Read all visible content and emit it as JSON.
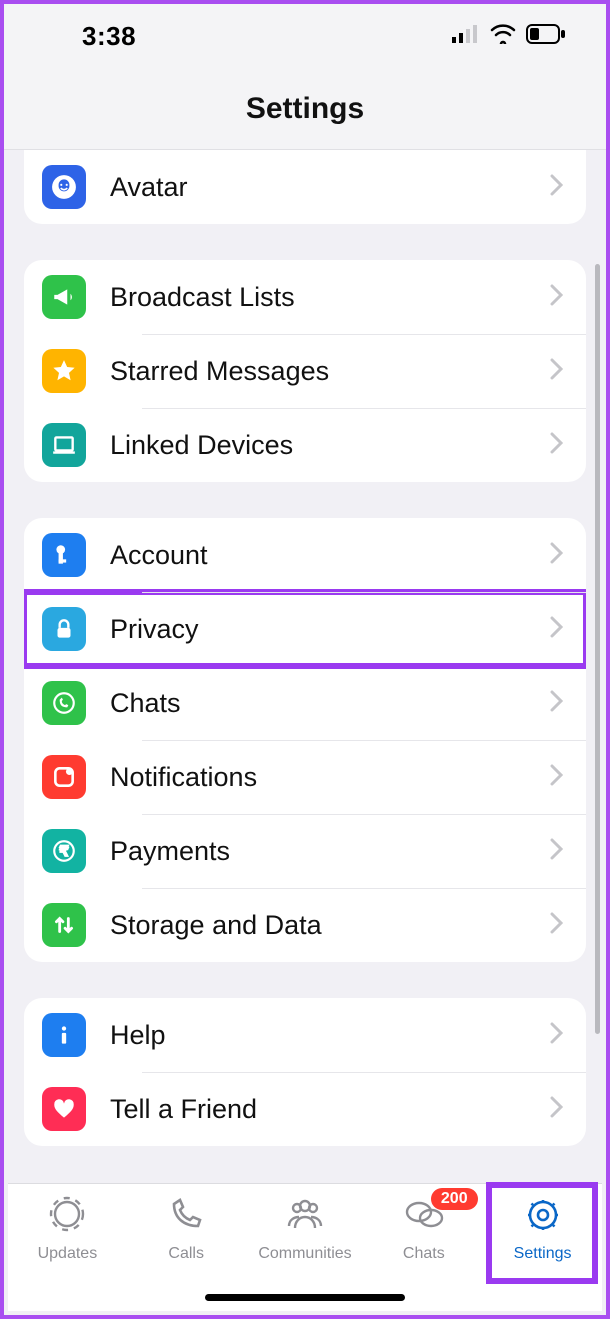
{
  "status": {
    "time": "3:38"
  },
  "header": {
    "title": "Settings"
  },
  "group1": {
    "avatar": "Avatar"
  },
  "group2": {
    "broadcast": "Broadcast Lists",
    "starred": "Starred Messages",
    "linked": "Linked Devices"
  },
  "group3": {
    "account": "Account",
    "privacy": "Privacy",
    "chats": "Chats",
    "notifications": "Notifications",
    "payments": "Payments",
    "storage": "Storage and Data"
  },
  "group4": {
    "help": "Help",
    "tell": "Tell a Friend"
  },
  "tabs": {
    "updates": "Updates",
    "calls": "Calls",
    "communities": "Communities",
    "chats": "Chats",
    "settings": "Settings",
    "chats_badge": "200"
  },
  "colors": {
    "avatar": "#2e63e7",
    "broadcast": "#2fc24a",
    "starred": "#ffb400",
    "linked": "#12a59b",
    "account": "#1e7ef0",
    "privacy": "#2aa8e0",
    "chats": "#2fc24a",
    "notifications": "#ff3b30",
    "payments": "#12b3a2",
    "storage": "#2fc24a",
    "help": "#1e7ef0",
    "tell": "#ff2d55",
    "highlight": "#9a3af0",
    "active_tab": "#0a67c7"
  }
}
